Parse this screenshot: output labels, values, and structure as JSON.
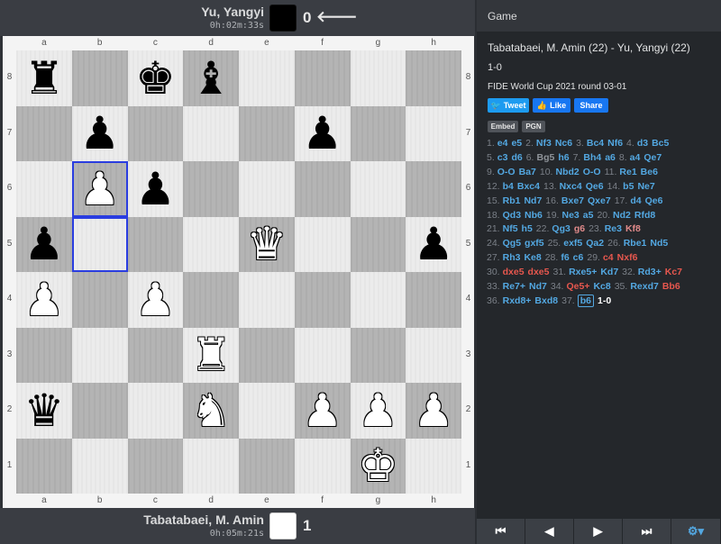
{
  "top_player": {
    "name": "Yu, Yangyi",
    "clock": "0h:02m:33s",
    "color": "black",
    "score": "0",
    "turn_arrow": "🡐"
  },
  "bottom_player": {
    "name": "Tabatabaei, M. Amin",
    "clock": "0h:05m:21s",
    "color": "white",
    "score": "1"
  },
  "board": {
    "files": [
      "a",
      "b",
      "c",
      "d",
      "e",
      "f",
      "g",
      "h"
    ],
    "ranks": [
      "8",
      "7",
      "6",
      "5",
      "4",
      "3",
      "2",
      "1"
    ],
    "highlight_squares": [
      "b6",
      "b5"
    ],
    "pieces": [
      {
        "square": "a8",
        "color": "b",
        "type": "rook",
        "glyph": "♜"
      },
      {
        "square": "c8",
        "color": "b",
        "type": "king",
        "glyph": "♚"
      },
      {
        "square": "d8",
        "color": "b",
        "type": "bishop",
        "glyph": "♝"
      },
      {
        "square": "b7",
        "color": "b",
        "type": "pawn",
        "glyph": "♟"
      },
      {
        "square": "f7",
        "color": "b",
        "type": "pawn",
        "glyph": "♟"
      },
      {
        "square": "b6",
        "color": "w",
        "type": "pawn",
        "glyph": "♟"
      },
      {
        "square": "c6",
        "color": "b",
        "type": "pawn",
        "glyph": "♟"
      },
      {
        "square": "a5",
        "color": "b",
        "type": "pawn",
        "glyph": "♟"
      },
      {
        "square": "e5",
        "color": "w",
        "type": "queen",
        "glyph": "♛"
      },
      {
        "square": "h5",
        "color": "b",
        "type": "pawn",
        "glyph": "♟"
      },
      {
        "square": "a4",
        "color": "w",
        "type": "pawn",
        "glyph": "♟"
      },
      {
        "square": "c4",
        "color": "w",
        "type": "pawn",
        "glyph": "♟"
      },
      {
        "square": "d3",
        "color": "w",
        "type": "rook",
        "glyph": "♜"
      },
      {
        "square": "a2",
        "color": "b",
        "type": "queen",
        "glyph": "♛"
      },
      {
        "square": "d2",
        "color": "w",
        "type": "knight",
        "glyph": "♞"
      },
      {
        "square": "f2",
        "color": "w",
        "type": "pawn",
        "glyph": "♟"
      },
      {
        "square": "g2",
        "color": "w",
        "type": "pawn",
        "glyph": "♟"
      },
      {
        "square": "h2",
        "color": "w",
        "type": "pawn",
        "glyph": "♟"
      },
      {
        "square": "g1",
        "color": "w",
        "type": "king",
        "glyph": "♚"
      }
    ]
  },
  "panel": {
    "header": "Game",
    "players_line": "Tabatabaei, M. Amin (22) - Yu, Yangyi (22)",
    "result": "1-0",
    "event": "FIDE World Cup 2021 round 03-01",
    "social": {
      "tweet": "Tweet",
      "like": "Like",
      "share": "Share"
    },
    "embed": "Embed",
    "pgn": "PGN"
  },
  "moves": [
    [
      {
        "n": "1."
      },
      {
        "m": "e4",
        "c": "blue"
      },
      {
        "m": "e5",
        "c": "blue"
      },
      {
        "n": "2."
      },
      {
        "m": "Nf3",
        "c": "blue"
      },
      {
        "m": "Nc6",
        "c": "blue"
      },
      {
        "n": "3."
      },
      {
        "m": "Bc4",
        "c": "blue"
      },
      {
        "m": "Nf6",
        "c": "blue"
      },
      {
        "n": "4."
      },
      {
        "m": "d3",
        "c": "blue"
      },
      {
        "m": "Bc5",
        "c": "blue"
      }
    ],
    [
      {
        "n": "5."
      },
      {
        "m": "c3",
        "c": "blue"
      },
      {
        "m": "d6",
        "c": "blue"
      },
      {
        "n": "6."
      },
      {
        "m": "Bg5",
        "c": "gray"
      },
      {
        "m": "h6",
        "c": "blue"
      },
      {
        "n": "7."
      },
      {
        "m": "Bh4",
        "c": "blue"
      },
      {
        "m": "a6",
        "c": "blue"
      },
      {
        "n": "8."
      },
      {
        "m": "a4",
        "c": "blue"
      },
      {
        "m": "Qe7",
        "c": "blue"
      }
    ],
    [
      {
        "n": "9."
      },
      {
        "m": "O-O",
        "c": "blue"
      },
      {
        "m": "Ba7",
        "c": "blue"
      },
      {
        "n": "10."
      },
      {
        "m": "Nbd2",
        "c": "blue"
      },
      {
        "m": "O-O",
        "c": "blue"
      },
      {
        "n": "11."
      },
      {
        "m": "Re1",
        "c": "blue"
      },
      {
        "m": "Be6",
        "c": "blue"
      }
    ],
    [
      {
        "n": "12."
      },
      {
        "m": "b4",
        "c": "blue"
      },
      {
        "m": "Bxc4",
        "c": "blue"
      },
      {
        "n": "13."
      },
      {
        "m": "Nxc4",
        "c": "blue"
      },
      {
        "m": "Qe6",
        "c": "blue"
      },
      {
        "n": "14."
      },
      {
        "m": "b5",
        "c": "blue"
      },
      {
        "m": "Ne7",
        "c": "blue"
      }
    ],
    [
      {
        "n": "15."
      },
      {
        "m": "Rb1",
        "c": "blue"
      },
      {
        "m": "Nd7",
        "c": "blue"
      },
      {
        "n": "16."
      },
      {
        "m": "Bxe7",
        "c": "blue"
      },
      {
        "m": "Qxe7",
        "c": "blue"
      },
      {
        "n": "17."
      },
      {
        "m": "d4",
        "c": "blue"
      },
      {
        "m": "Qe6",
        "c": "blue"
      }
    ],
    [
      {
        "n": "18."
      },
      {
        "m": "Qd3",
        "c": "blue"
      },
      {
        "m": "Nb6",
        "c": "blue"
      },
      {
        "n": "19."
      },
      {
        "m": "Ne3",
        "c": "blue"
      },
      {
        "m": "a5",
        "c": "blue"
      },
      {
        "n": "20."
      },
      {
        "m": "Nd2",
        "c": "blue"
      },
      {
        "m": "Rfd8",
        "c": "blue"
      }
    ],
    [
      {
        "n": "21."
      },
      {
        "m": "Nf5",
        "c": "blue"
      },
      {
        "m": "h5",
        "c": "blue"
      },
      {
        "n": "22."
      },
      {
        "m": "Qg3",
        "c": "blue"
      },
      {
        "m": "g6",
        "c": "pink"
      },
      {
        "n": "23."
      },
      {
        "m": "Re3",
        "c": "blue"
      },
      {
        "m": "Kf8",
        "c": "pink"
      }
    ],
    [
      {
        "n": "24."
      },
      {
        "m": "Qg5",
        "c": "blue"
      },
      {
        "m": "gxf5",
        "c": "blue"
      },
      {
        "n": "25."
      },
      {
        "m": "exf5",
        "c": "blue"
      },
      {
        "m": "Qa2",
        "c": "blue"
      },
      {
        "n": "26."
      },
      {
        "m": "Rbe1",
        "c": "blue"
      },
      {
        "m": "Nd5",
        "c": "blue"
      }
    ],
    [
      {
        "n": "27."
      },
      {
        "m": "Rh3",
        "c": "blue"
      },
      {
        "m": "Ke8",
        "c": "blue"
      },
      {
        "n": "28."
      },
      {
        "m": "f6",
        "c": "blue"
      },
      {
        "m": "c6",
        "c": "blue"
      },
      {
        "n": "29."
      },
      {
        "m": "c4",
        "c": "red"
      },
      {
        "m": "Nxf6",
        "c": "red"
      }
    ],
    [
      {
        "n": "30."
      },
      {
        "m": "dxe5",
        "c": "red"
      },
      {
        "m": "dxe5",
        "c": "red"
      },
      {
        "n": "31."
      },
      {
        "m": "Rxe5+",
        "c": "blue"
      },
      {
        "m": "Kd7",
        "c": "blue"
      },
      {
        "n": "32."
      },
      {
        "m": "Rd3+",
        "c": "blue"
      },
      {
        "m": "Kc7",
        "c": "red"
      }
    ],
    [
      {
        "n": "33."
      },
      {
        "m": "Re7+",
        "c": "blue"
      },
      {
        "m": "Nd7",
        "c": "blue"
      },
      {
        "n": "34."
      },
      {
        "m": "Qe5+",
        "c": "red"
      },
      {
        "m": "Kc8",
        "c": "blue"
      },
      {
        "n": "35."
      },
      {
        "m": "Rexd7",
        "c": "blue"
      },
      {
        "m": "Bb6",
        "c": "red"
      }
    ],
    [
      {
        "n": "36."
      },
      {
        "m": "Rxd8+",
        "c": "blue"
      },
      {
        "m": "Bxd8",
        "c": "blue"
      },
      {
        "n": "37."
      },
      {
        "m": "b6",
        "c": "cur"
      },
      {
        "r": "1-0"
      }
    ]
  ],
  "nav": {
    "first": "⏮",
    "prev": "◀",
    "next": "▶",
    "last": "⏭",
    "settings": "⚙▾"
  }
}
